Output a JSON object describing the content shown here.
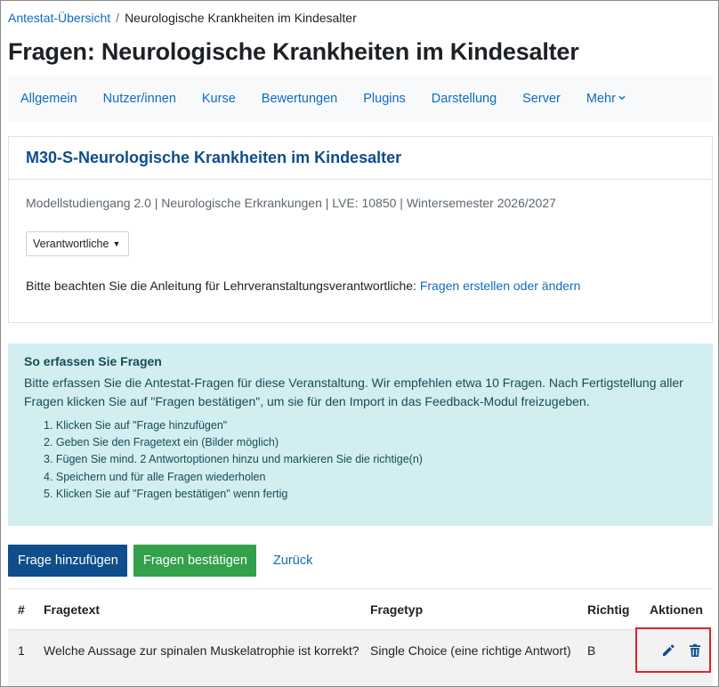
{
  "breadcrumb": {
    "parent": "Antestat-Übersicht",
    "separator": "/",
    "current": "Neurologische Krankheiten im Kindesalter"
  },
  "page_title": "Fragen: Neurologische Krankheiten im Kindesalter",
  "nav_tabs": [
    "Allgemein",
    "Nutzer/innen",
    "Kurse",
    "Bewertungen",
    "Plugins",
    "Darstellung",
    "Server"
  ],
  "nav_more": "Mehr",
  "course": {
    "title": "M30-S-Neurologische Krankheiten im Kindesalter",
    "meta": "Modellstudiengang 2.0 | Neurologische Erkrankungen | LVE: 10850 | Wintersemester 2026/2027",
    "dropdown_label": "Verantwortliche",
    "note_prefix": "Bitte beachten Sie die Anleitung für Lehrveranstaltungsverantwortliche:",
    "note_link": "Fragen erstellen oder ändern"
  },
  "info": {
    "title": "So erfassen Sie Fragen",
    "text": "Bitte erfassen Sie die Antestat-Fragen für diese Veranstaltung. Wir empfehlen etwa 10 Fragen. Nach Fertigstellung aller Fragen klicken Sie auf \"Fragen bestätigen\", um sie für den Import in das Feedback-Modul freizugeben.",
    "steps": [
      "1. Klicken Sie auf \"Frage hinzufügen\"",
      "2. Geben Sie den Fragetext ein (Bilder möglich)",
      "3. Fügen Sie mind. 2 Antwortoptionen hinzu und markieren Sie die richtige(n)",
      "4. Speichern und für alle Fragen wiederholen",
      "5. Klicken Sie auf \"Fragen bestätigen\" wenn fertig"
    ]
  },
  "buttons": {
    "add": "Frage hinzufügen",
    "confirm": "Fragen bestätigen",
    "back": "Zurück"
  },
  "table": {
    "headers": {
      "num": "#",
      "text": "Fragetext",
      "type": "Fragetyp",
      "correct": "Richtig",
      "actions": "Aktionen"
    },
    "rows": [
      {
        "num": "1",
        "text": "Welche Aussage zur spinalen Muskelatrophie ist korrekt?",
        "type": "Single Choice (eine richtige Antwort)",
        "correct": "B"
      }
    ]
  },
  "colors": {
    "link": "#0f6cbf",
    "primary": "#0f4d8c",
    "success": "#33a04b",
    "info_bg": "#d3eef1",
    "delete_icon": "#0f4d8c",
    "highlight": "#d9262c"
  },
  "icons": {
    "edit": "pencil-icon",
    "delete": "trash-icon",
    "more_caret": "chevron-down-icon",
    "dropdown_caret": "caret-down-icon"
  }
}
